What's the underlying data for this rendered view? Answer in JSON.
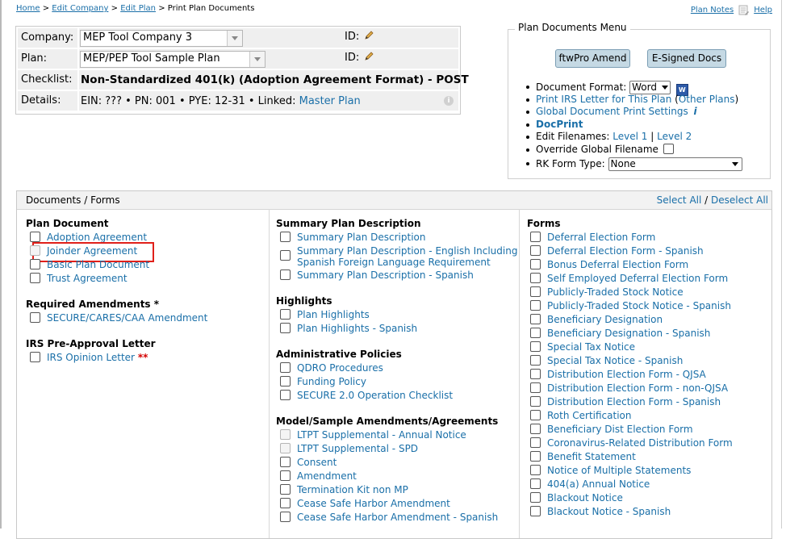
{
  "breadcrumb": {
    "home": "Home",
    "sep1": ">",
    "edit_company": "Edit Company",
    "sep2": ">",
    "edit_plan": "Edit Plan",
    "sep3": ">",
    "current": "Print Plan Documents"
  },
  "topright": {
    "plan_notes": "Plan Notes",
    "help": "Help"
  },
  "plan_info": {
    "company_label": "Company:",
    "company_value": "MEP Tool Company 3",
    "plan_label": "Plan:",
    "plan_value": "MEP/PEP Tool Sample Plan",
    "id_label": "ID:",
    "checklist_label": "Checklist:",
    "checklist_value": "Non-Standardized 401(k) (Adoption Agreement Format) - POST",
    "details_label": "Details:",
    "details_text": "EIN: ??? • PN: 001 • PYE: 12-31 • Linked:",
    "details_link": "Master Plan"
  },
  "menu": {
    "title": "Plan Documents Menu",
    "btn_amend": "ftwPro Amend",
    "btn_esigned": "E-Signed Docs",
    "doc_format_label": "Document Format:",
    "doc_format_value": "Word",
    "print_irs": "Print IRS Letter for This Plan",
    "paren_open": "(",
    "other_plans": "Other Plans",
    "paren_close": ")",
    "global_settings": "Global Document Print Settings",
    "info_glyph": "i",
    "docprint": "DocPrint",
    "edit_filenames": "Edit Filenames:",
    "level1": "Level 1",
    "pipe": "|",
    "level2": "Level 2",
    "override": "Override Global Filename",
    "rk_label": "RK Form Type:",
    "rk_value": "None"
  },
  "docs": {
    "title": "Documents / Forms",
    "select_all": "Select All",
    "slash": "/",
    "deselect_all": "Deselect All",
    "col1": {
      "plan_document": {
        "title": "Plan Document",
        "items": [
          "Adoption Agreement",
          "Joinder Agreement",
          "Basic Plan Document",
          "Trust Agreement"
        ]
      },
      "required_amendments": {
        "title": "Required Amendments *",
        "items": [
          "SECURE/CARES/CAA Amendment"
        ]
      },
      "irs_letter": {
        "title": "IRS Pre-Approval Letter",
        "item": "IRS Opinion Letter",
        "stars": "**"
      }
    },
    "col2": {
      "spd": {
        "title": "Summary Plan Description",
        "items": [
          "Summary Plan Description",
          "Summary Plan Description - English Including",
          "Spanish Foreign Language Requirement",
          "Summary Plan Description - Spanish"
        ]
      },
      "highlights": {
        "title": "Highlights",
        "items": [
          "Plan Highlights",
          "Plan Highlights - Spanish"
        ]
      },
      "admin": {
        "title": "Administrative Policies",
        "items": [
          "QDRO Procedures",
          "Funding Policy",
          "SECURE 2.0 Operation Checklist"
        ]
      },
      "model": {
        "title": "Model/Sample Amendments/Agreements",
        "items": [
          "LTPT Supplemental - Annual Notice",
          "LTPT Supplemental - SPD",
          "Consent",
          "Amendment",
          "Termination Kit non MP",
          "Cease Safe Harbor Amendment",
          "Cease Safe Harbor Amendment - Spanish"
        ]
      }
    },
    "col3": {
      "title": "Forms",
      "items": [
        "Deferral Election Form",
        "Deferral Election Form - Spanish",
        "Bonus Deferral Election Form",
        "Self Employed Deferral Election Form",
        "Publicly-Traded Stock Notice",
        "Publicly-Traded Stock Notice - Spanish",
        "Beneficiary Designation",
        "Beneficiary Designation - Spanish",
        "Special Tax Notice",
        "Special Tax Notice - Spanish",
        "Distribution Election Form - QJSA",
        "Distribution Election Form - non-QJSA",
        "Distribution Election Form - Spanish",
        "Roth Certification",
        "Beneficiary Dist Election Form",
        "Coronavirus-Related Distribution Form",
        "Benefit Statement",
        "Notice of Multiple Statements",
        "404(a) Annual Notice",
        "Blackout Notice",
        "Blackout Notice - Spanish"
      ]
    }
  }
}
